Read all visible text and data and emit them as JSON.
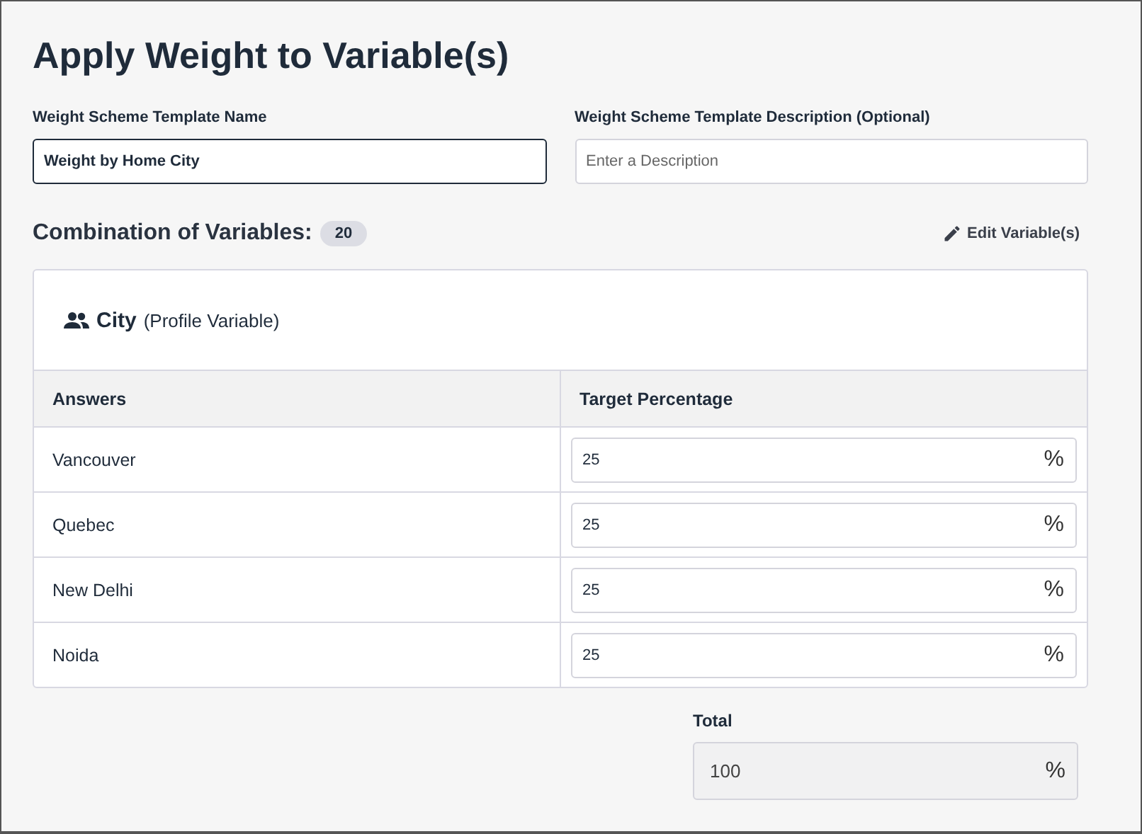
{
  "title": "Apply Weight to Variable(s)",
  "name_field": {
    "label": "Weight Scheme Template Name",
    "value": "Weight by Home City",
    "focused": true
  },
  "description_field": {
    "label": "Weight Scheme Template Description (Optional)",
    "placeholder": "Enter a Description"
  },
  "combination": {
    "label": "Combination of Variables:",
    "count": "20"
  },
  "edit_button": {
    "label": "Edit Variable(s)"
  },
  "variable": {
    "name": "City",
    "type": "(Profile Variable)"
  },
  "table": {
    "columns": [
      "Answers",
      "Target Percentage"
    ],
    "rows": [
      {
        "answer": "Vancouver",
        "value": "25",
        "unit": "%"
      },
      {
        "answer": "Quebec",
        "value": "25",
        "unit": "%"
      },
      {
        "answer": "New Delhi",
        "value": "25",
        "unit": "%"
      },
      {
        "answer": "Noida",
        "value": "25",
        "unit": "%"
      }
    ]
  },
  "total": {
    "label": "Total",
    "value": "100",
    "unit": "%",
    "disabled": true
  }
}
